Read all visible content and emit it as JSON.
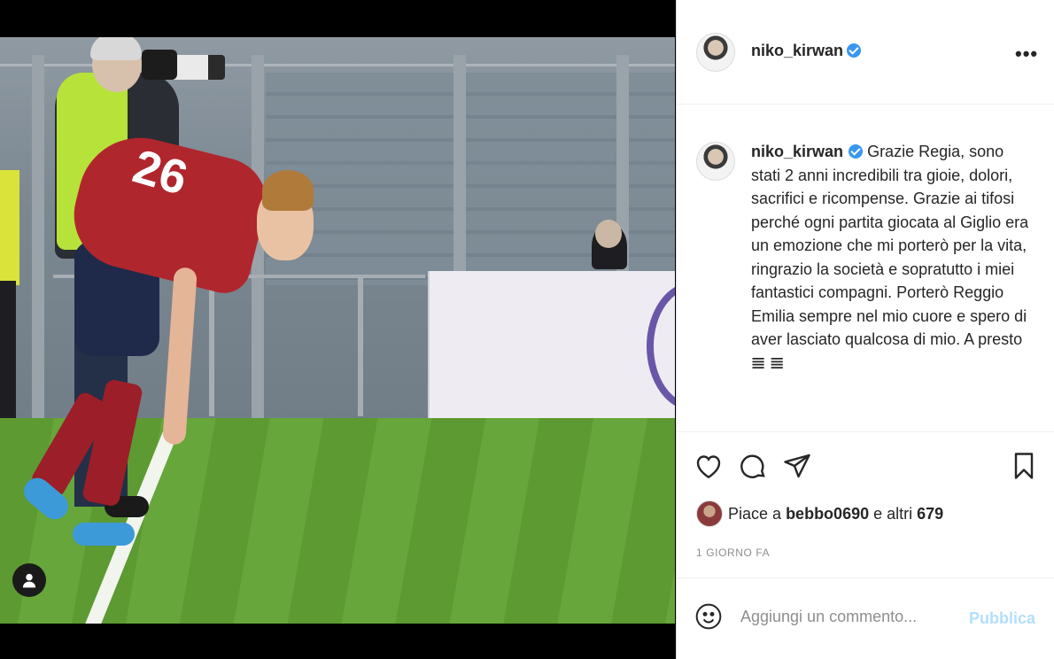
{
  "post": {
    "author": "niko_kirwan",
    "verified": true,
    "more_label": "•••",
    "caption_text": "Grazie Regia, sono stati 2 anni incredibili tra gioie, dolori, sacrifici e ricompense. Grazie ai tifosi perché ogni partita giocata al Giglio era un emozione che mi porterò per la vita, ringrazio la società e sopratutto i miei fantastici compagni. Porterò Reggio Emilia sempre nel mio cuore e spero di aver lasciato qualcosa di mio. A presto",
    "caption_emoji_1": "𝌆",
    "caption_emoji_2": "𝌆",
    "player_number": "26"
  },
  "likes": {
    "prefix": "Piace a",
    "user": "bebbo0690",
    "middle": "e altri",
    "count": "679"
  },
  "timestamp": "1 GIORNO FA",
  "comment_box": {
    "placeholder": "Aggiungi un commento...",
    "publish_label": "Pubblica"
  },
  "icons": {
    "like": "heart-icon",
    "comment": "comment-icon",
    "share": "paper-plane-icon",
    "save": "bookmark-icon",
    "emoji": "smiley-icon",
    "tag": "user-tag-icon"
  },
  "colors": {
    "verified": "#3897f0",
    "publish_disabled": "#b2dffc",
    "meta": "#8e8e8e"
  }
}
